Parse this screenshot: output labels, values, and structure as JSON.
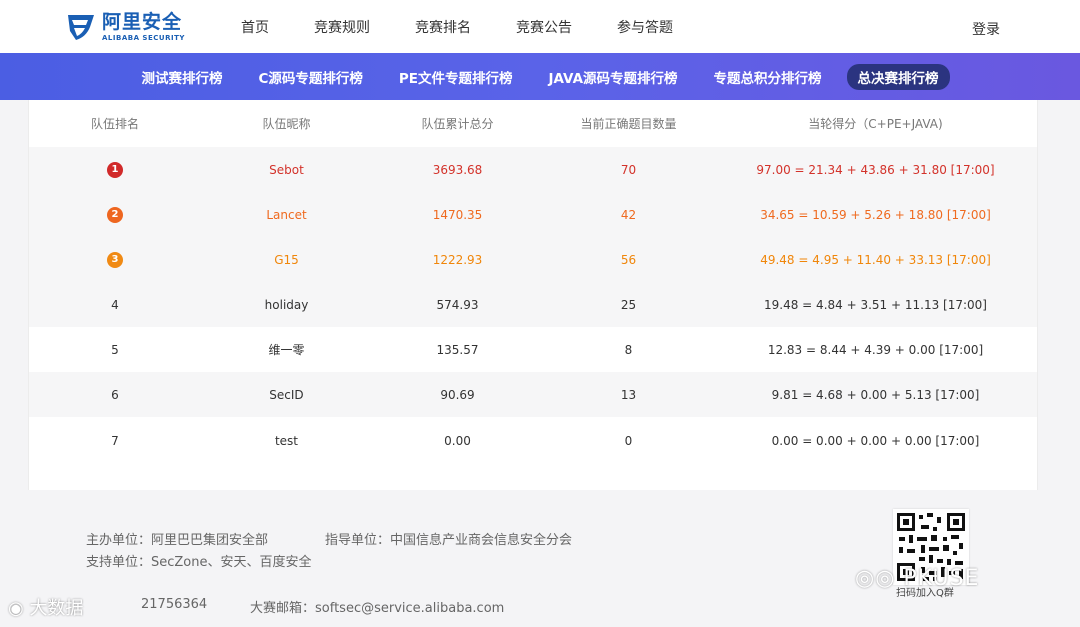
{
  "header": {
    "logo_cn": "阿里安全",
    "logo_en": "ALIBABA SECURITY",
    "nav": [
      "首页",
      "竞赛规则",
      "竞赛排名",
      "竞赛公告",
      "参与答题"
    ],
    "login": "登录"
  },
  "subnav": {
    "tabs": [
      "测试赛排行榜",
      "C源码专题排行榜",
      "PE文件专题排行榜",
      "JAVA源码专题排行榜",
      "专题总积分排行榜",
      "总决赛排行榜"
    ],
    "active": "总决赛排行榜"
  },
  "table": {
    "headers": [
      "队伍排名",
      "队伍昵称",
      "队伍累计总分",
      "当前正确题目数量",
      "当轮得分（C+PE+JAVA)"
    ],
    "rows": [
      {
        "rank": "1",
        "name": "Sebot",
        "total": "3693.68",
        "correct": "70",
        "round": "97.00 = 21.34 + 43.86 + 31.80 [17:00]"
      },
      {
        "rank": "2",
        "name": "Lancet",
        "total": "1470.35",
        "correct": "42",
        "round": "34.65 = 10.59 + 5.26 + 18.80 [17:00]"
      },
      {
        "rank": "3",
        "name": "G15",
        "total": "1222.93",
        "correct": "56",
        "round": "49.48 = 4.95 + 11.40 + 33.13 [17:00]"
      },
      {
        "rank": "4",
        "name": "holiday",
        "total": "574.93",
        "correct": "25",
        "round": "19.48 = 4.84 + 3.51 + 11.13 [17:00]"
      },
      {
        "rank": "5",
        "name": "维一零",
        "total": "135.57",
        "correct": "8",
        "round": "12.83 = 8.44 + 4.39 + 0.00 [17:00]"
      },
      {
        "rank": "6",
        "name": "SecID",
        "total": "90.69",
        "correct": "13",
        "round": "9.81 = 4.68 + 0.00 + 5.13 [17:00]"
      },
      {
        "rank": "7",
        "name": "test",
        "total": "0.00",
        "correct": "0",
        "round": "0.00 = 0.00 + 0.00 + 0.00 [17:00]"
      }
    ]
  },
  "footer": {
    "host": "主办单位：阿里巴巴集团安全部",
    "guide": "指导单位：中国信息产业商会信息安全分会",
    "support": "支持单位：SecZone、安天、百度安全",
    "phone_partial": "21756364",
    "email": "大赛邮箱：softsec@service.alibaba.com",
    "qr_caption": "扫码加入Q群"
  },
  "watermarks": {
    "right": "PKUSE",
    "left": "大数据"
  },
  "colors": {
    "brand_blue": "#1a5fb4",
    "band_start": "#4b5ee3",
    "band_end": "#6a58e0",
    "active_tab": "#2b3480",
    "rank1": "#d3322a",
    "rank2": "#ef6a1f",
    "rank3": "#f0860a"
  }
}
